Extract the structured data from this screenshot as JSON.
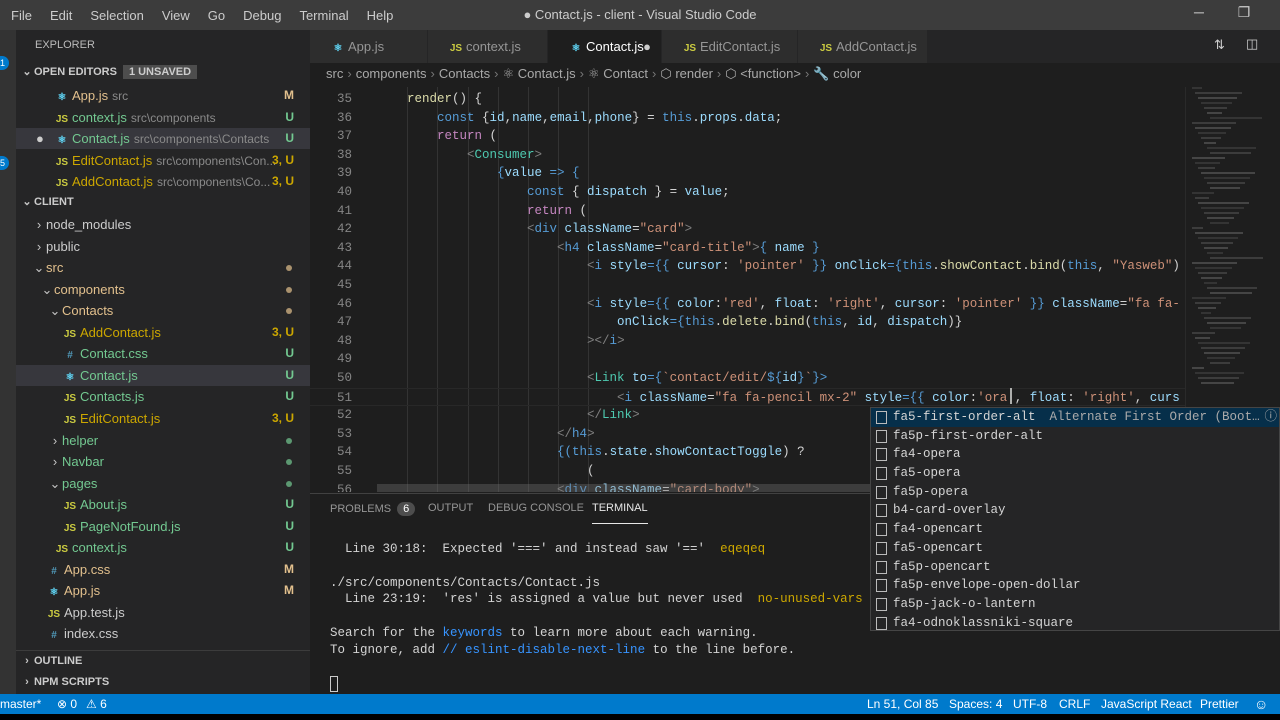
{
  "title_bar": {
    "menu": [
      "File",
      "Edit",
      "Selection",
      "View",
      "Go",
      "Debug",
      "Terminal",
      "Help"
    ],
    "title": "● Contact.js - client - Visual Studio Code",
    "minimize": "─",
    "restore": "❐"
  },
  "activity": {
    "badges": [
      "1",
      "5"
    ]
  },
  "sidebar": {
    "header": "EXPLORER",
    "open_editors": {
      "label": "OPEN EDITORS",
      "badge": "1 UNSAVED",
      "items": [
        {
          "icon": "react",
          "label": "App.js",
          "desc": "src",
          "status": "M",
          "color": "#e2c08d"
        },
        {
          "icon": "js",
          "label": "context.js",
          "desc": "src\\components",
          "status": "U",
          "color": "#73c991"
        },
        {
          "icon": "react",
          "label": "Contact.js",
          "desc": "src\\components\\Contacts",
          "status": "U",
          "color": "#73c991",
          "dirty": true
        },
        {
          "icon": "js",
          "label": "EditContact.js",
          "desc": "src\\components\\Con...",
          "status": "3, U",
          "color": "#cca700"
        },
        {
          "icon": "js",
          "label": "AddContact.js",
          "desc": "src\\components\\Co...",
          "status": "3, U",
          "color": "#cca700"
        }
      ]
    },
    "project": {
      "label": "CLIENT",
      "items": [
        {
          "kind": "folder",
          "open": false,
          "label": "node_modules",
          "depth": 0,
          "color": "#ccc"
        },
        {
          "kind": "folder",
          "open": false,
          "label": "public",
          "depth": 0,
          "color": "#ccc"
        },
        {
          "kind": "folder",
          "open": true,
          "label": "src",
          "depth": 0,
          "color": "#e2c08d",
          "dot": "#e2c08d"
        },
        {
          "kind": "folder",
          "open": true,
          "label": "components",
          "depth": 1,
          "color": "#e2c08d",
          "dot": "#e2c08d"
        },
        {
          "kind": "folder",
          "open": true,
          "label": "Contacts",
          "depth": 2,
          "color": "#e2c08d",
          "dot": "#e2c08d"
        },
        {
          "kind": "file",
          "icon": "js",
          "label": "AddContact.js",
          "depth": 3,
          "status": "3, U",
          "color": "#cca700"
        },
        {
          "kind": "file",
          "icon": "css",
          "label": "Contact.css",
          "depth": 3,
          "status": "U",
          "color": "#73c991"
        },
        {
          "kind": "file",
          "icon": "react",
          "label": "Contact.js",
          "depth": 3,
          "status": "U",
          "color": "#73c991",
          "selected": true
        },
        {
          "kind": "file",
          "icon": "js",
          "label": "Contacts.js",
          "depth": 3,
          "status": "U",
          "color": "#73c991"
        },
        {
          "kind": "file",
          "icon": "js",
          "label": "EditContact.js",
          "depth": 3,
          "status": "3, U",
          "color": "#cca700"
        },
        {
          "kind": "folder",
          "open": false,
          "label": "helper",
          "depth": 2,
          "color": "#73c991",
          "dot": "#73c991"
        },
        {
          "kind": "folder",
          "open": false,
          "label": "Navbar",
          "depth": 2,
          "color": "#73c991",
          "dot": "#73c991"
        },
        {
          "kind": "folder",
          "open": true,
          "label": "pages",
          "depth": 2,
          "color": "#73c991",
          "dot": "#73c991"
        },
        {
          "kind": "file",
          "icon": "js",
          "label": "About.js",
          "depth": 3,
          "status": "U",
          "color": "#73c991"
        },
        {
          "kind": "file",
          "icon": "js",
          "label": "PageNotFound.js",
          "depth": 3,
          "status": "U",
          "color": "#73c991"
        },
        {
          "kind": "file",
          "icon": "js",
          "label": "context.js",
          "depth": 2,
          "status": "U",
          "color": "#73c991"
        },
        {
          "kind": "file",
          "icon": "css",
          "label": "App.css",
          "depth": 1,
          "status": "M",
          "color": "#e2c08d"
        },
        {
          "kind": "file",
          "icon": "react",
          "label": "App.js",
          "depth": 1,
          "status": "M",
          "color": "#e2c08d"
        },
        {
          "kind": "file",
          "icon": "js",
          "label": "App.test.js",
          "depth": 1,
          "color": "#ccc"
        },
        {
          "kind": "file",
          "icon": "css",
          "label": "index.css",
          "depth": 1,
          "color": "#ccc"
        }
      ]
    },
    "outline": "OUTLINE",
    "npm_scripts": "NPM SCRIPTS"
  },
  "tabs": [
    {
      "icon": "react",
      "label": "App.js"
    },
    {
      "icon": "js",
      "label": "context.js"
    },
    {
      "icon": "react",
      "label": "Contact.js",
      "active": true,
      "dirty": true
    },
    {
      "icon": "js",
      "label": "EditContact.js"
    },
    {
      "icon": "js",
      "label": "AddContact.js"
    }
  ],
  "breadcrumb": [
    "src",
    "components",
    "Contacts",
    "⚛ Contact.js",
    "⚛ Contact",
    "⬡ render",
    "⬡ <function>",
    "🔧 color"
  ],
  "editor": {
    "first_line": 35,
    "current_line": 51,
    "lines": [
      [
        [
          "    render",
          "f"
        ],
        [
          "() {",
          "p"
        ]
      ],
      [
        [
          "        const",
          "k"
        ],
        [
          " {",
          "p"
        ],
        [
          "id",
          "v"
        ],
        [
          ",",
          "p"
        ],
        [
          "name",
          "v"
        ],
        [
          ",",
          "p"
        ],
        [
          "email",
          "v"
        ],
        [
          ",",
          "p"
        ],
        [
          "phone",
          "v"
        ],
        [
          "} = ",
          "p"
        ],
        [
          "this",
          "k"
        ],
        [
          ".",
          "p"
        ],
        [
          "props",
          "v"
        ],
        [
          ".",
          "p"
        ],
        [
          "data",
          "v"
        ],
        [
          ";",
          "p"
        ]
      ],
      [
        [
          "        return",
          "c"
        ],
        [
          " (",
          "p"
        ]
      ],
      [
        [
          "            <",
          "g"
        ],
        [
          "Consumer",
          "m"
        ],
        [
          ">",
          "g"
        ]
      ],
      [
        [
          "                {",
          "k"
        ],
        [
          "value",
          "v"
        ],
        [
          " => {",
          "k"
        ]
      ],
      [
        [
          "                    const",
          "k"
        ],
        [
          " { ",
          "p"
        ],
        [
          "dispatch",
          "v"
        ],
        [
          " } = ",
          "p"
        ],
        [
          "value",
          "v"
        ],
        [
          ";",
          "p"
        ]
      ],
      [
        [
          "                    return",
          "c"
        ],
        [
          " (",
          "p"
        ]
      ],
      [
        [
          "                    <",
          "g"
        ],
        [
          "div",
          "t"
        ],
        [
          " className",
          "v"
        ],
        [
          "=",
          "p"
        ],
        [
          "\"card\"",
          "s"
        ],
        [
          ">",
          "g"
        ]
      ],
      [
        [
          "                        <",
          "g"
        ],
        [
          "h4",
          "t"
        ],
        [
          " className",
          "v"
        ],
        [
          "=",
          "p"
        ],
        [
          "\"card-title\"",
          "s"
        ],
        [
          ">",
          "g"
        ],
        [
          "{ ",
          "k"
        ],
        [
          "name",
          "v"
        ],
        [
          " }",
          "k"
        ]
      ],
      [
        [
          "                            <",
          "g"
        ],
        [
          "i",
          "t"
        ],
        [
          " style",
          "v"
        ],
        [
          "={{ ",
          "k"
        ],
        [
          "cursor",
          "v"
        ],
        [
          ": ",
          "p"
        ],
        [
          "'pointer'",
          "s"
        ],
        [
          " }} ",
          "k"
        ],
        [
          "onClick",
          "v"
        ],
        [
          "={",
          "k"
        ],
        [
          "this",
          "k"
        ],
        [
          ".",
          "p"
        ],
        [
          "showContact",
          "f"
        ],
        [
          ".",
          "p"
        ],
        [
          "bind",
          "f"
        ],
        [
          "(",
          "p"
        ],
        [
          "this",
          "k"
        ],
        [
          ", ",
          "p"
        ],
        [
          "\"Yasweb\"",
          "s"
        ],
        [
          ")",
          "p"
        ]
      ],
      [],
      [
        [
          "                            <",
          "g"
        ],
        [
          "i",
          "t"
        ],
        [
          " style",
          "v"
        ],
        [
          "={{ ",
          "k"
        ],
        [
          "color",
          "v"
        ],
        [
          ":",
          "p"
        ],
        [
          "'red'",
          "s"
        ],
        [
          ", ",
          "p"
        ],
        [
          "float",
          "v"
        ],
        [
          ": ",
          "p"
        ],
        [
          "'right'",
          "s"
        ],
        [
          ", ",
          "p"
        ],
        [
          "cursor",
          "v"
        ],
        [
          ": ",
          "p"
        ],
        [
          "'pointer'",
          "s"
        ],
        [
          " }} ",
          "k"
        ],
        [
          "className",
          "v"
        ],
        [
          "=",
          "p"
        ],
        [
          "\"fa fa-",
          "s"
        ]
      ],
      [
        [
          "                                onClick",
          "v"
        ],
        [
          "={",
          "k"
        ],
        [
          "this",
          "k"
        ],
        [
          ".",
          "p"
        ],
        [
          "delete",
          "f"
        ],
        [
          ".",
          "p"
        ],
        [
          "bind",
          "f"
        ],
        [
          "(",
          "p"
        ],
        [
          "this",
          "k"
        ],
        [
          ", ",
          "p"
        ],
        [
          "id",
          "v"
        ],
        [
          ", ",
          "p"
        ],
        [
          "dispatch",
          "v"
        ],
        [
          ")}",
          "p"
        ]
      ],
      [
        [
          "                            ></",
          "g"
        ],
        [
          "i",
          "t"
        ],
        [
          ">",
          "g"
        ]
      ],
      [],
      [
        [
          "                            <",
          "g"
        ],
        [
          "Link",
          "m"
        ],
        [
          " to",
          "v"
        ],
        [
          "={",
          "k"
        ],
        [
          "`contact/edit/",
          "s"
        ],
        [
          "${",
          "k"
        ],
        [
          "id",
          "v"
        ],
        [
          "}",
          "k"
        ],
        [
          "`",
          "s"
        ],
        [
          "}>",
          "k"
        ]
      ],
      [
        [
          "                                <",
          "g"
        ],
        [
          "i",
          "t"
        ],
        [
          " className",
          "v"
        ],
        [
          "=",
          "p"
        ],
        [
          "\"fa fa-pencil mx-2\"",
          "s"
        ],
        [
          " style",
          "v"
        ],
        [
          "={{ ",
          "k"
        ],
        [
          "color",
          "v"
        ],
        [
          ":",
          "p"
        ],
        [
          "'ora'",
          "s"
        ],
        [
          ", ",
          "p"
        ],
        [
          "float",
          "v"
        ],
        [
          ": ",
          "p"
        ],
        [
          "'right'",
          "s"
        ],
        [
          ", ",
          "p"
        ],
        [
          "curs",
          "v"
        ]
      ],
      [
        [
          "                            </",
          "g"
        ],
        [
          "Link",
          "m"
        ],
        [
          ">",
          "g"
        ]
      ],
      [
        [
          "                        </",
          "g"
        ],
        [
          "h4",
          "t"
        ],
        [
          ">",
          "g"
        ]
      ],
      [
        [
          "                        {(",
          "k"
        ],
        [
          "this",
          "k"
        ],
        [
          ".",
          "p"
        ],
        [
          "state",
          "v"
        ],
        [
          ".",
          "p"
        ],
        [
          "showContactToggle",
          "v"
        ],
        [
          ") ?",
          "p"
        ]
      ],
      [
        [
          "                            (",
          "p"
        ]
      ],
      [
        [
          "                        <",
          "g"
        ],
        [
          "div",
          "t"
        ],
        [
          " className",
          "v"
        ],
        [
          "=",
          "p"
        ],
        [
          "\"card-body\"",
          "s"
        ],
        [
          ">",
          "g"
        ]
      ]
    ]
  },
  "suggest": {
    "items": [
      {
        "label": "fa5-first-order-alt",
        "detail": "Alternate First Order (Boot…",
        "selected": true
      },
      {
        "label": "fa5p-first-order-alt"
      },
      {
        "label": "fa4-opera"
      },
      {
        "label": "fa5-opera"
      },
      {
        "label": "fa5p-opera"
      },
      {
        "label": "b4-card-overlay"
      },
      {
        "label": "fa4-opencart"
      },
      {
        "label": "fa5-opencart"
      },
      {
        "label": "fa5p-opencart"
      },
      {
        "label": "fa5p-envelope-open-dollar"
      },
      {
        "label": "fa5p-jack-o-lantern"
      },
      {
        "label": "fa4-odnoklassniki-square"
      }
    ],
    "info": "ⓘ"
  },
  "panel": {
    "tabs": [
      {
        "label": "PROBLEMS",
        "badge": "6"
      },
      {
        "label": "OUTPUT"
      },
      {
        "label": "DEBUG CONSOLE"
      },
      {
        "label": "TERMINAL",
        "active": true
      }
    ],
    "terminal": [
      [
        [
          "  Line 30:18:  Expected '===' and instead saw '=='  ",
          "p"
        ],
        [
          "eqeqeq",
          "w"
        ]
      ],
      [],
      [
        [
          "./src/components/Contacts/Contact.js",
          "p"
        ]
      ],
      [
        [
          "  Line 23:19:  'res' is assigned a value but never used  ",
          "p"
        ],
        [
          "no-unused-vars",
          "w"
        ]
      ],
      [],
      [
        [
          "Search for the ",
          "p"
        ],
        [
          "keywords",
          "b"
        ],
        [
          " to learn more about each warning.",
          "p"
        ]
      ],
      [
        [
          "To ignore, add ",
          "p"
        ],
        [
          "// eslint-disable-next-line",
          "b"
        ],
        [
          " to the line before.",
          "p"
        ]
      ]
    ]
  },
  "status_bar": {
    "branch": "master*",
    "errors": "⊗ 0",
    "warnings": "⚠ 6",
    "position": "Ln 51, Col 85",
    "spaces": "Spaces: 4",
    "encoding": "UTF-8",
    "eol": "CRLF",
    "language": "JavaScript React",
    "formatter": "Prettier",
    "feedback": "☺"
  }
}
